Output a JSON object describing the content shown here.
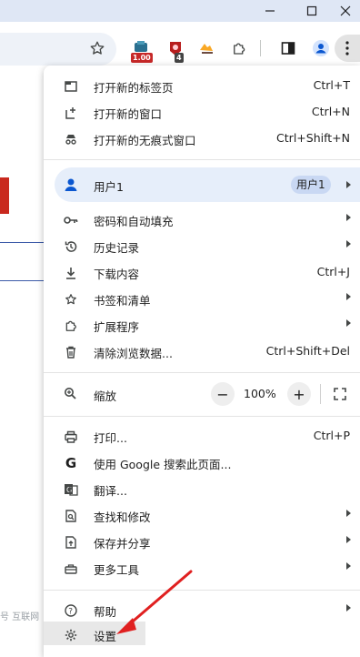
{
  "toolbar": {
    "extension_badge_1": "1.00",
    "extension_badge_2": "4"
  },
  "menu": {
    "new_tab": {
      "label": "打开新的标签页",
      "shortcut": "Ctrl+T"
    },
    "new_window": {
      "label": "打开新的窗口",
      "shortcut": "Ctrl+N"
    },
    "new_incognito": {
      "label": "打开新的无痕式窗口",
      "shortcut": "Ctrl+Shift+N"
    },
    "profile": {
      "label": "用户1",
      "chip": "用户1"
    },
    "passwords": {
      "label": "密码和自动填充"
    },
    "history": {
      "label": "历史记录"
    },
    "downloads": {
      "label": "下载内容",
      "shortcut": "Ctrl+J"
    },
    "bookmarks": {
      "label": "书签和清单"
    },
    "extensions": {
      "label": "扩展程序"
    },
    "clear_data": {
      "label": "清除浏览数据...",
      "shortcut": "Ctrl+Shift+Del"
    },
    "zoom": {
      "label": "缩放",
      "minus": "−",
      "value": "100%",
      "plus": "+"
    },
    "print": {
      "label": "打印...",
      "shortcut": "Ctrl+P"
    },
    "google_search": {
      "label": "使用 Google 搜索此页面..."
    },
    "translate": {
      "label": "翻译..."
    },
    "find_edit": {
      "label": "查找和修改"
    },
    "save_share": {
      "label": "保存并分享"
    },
    "more_tools": {
      "label": "更多工具"
    },
    "help": {
      "label": "帮助"
    },
    "settings": {
      "label": "设置"
    }
  },
  "background": {
    "footer_text": "号   互联网"
  },
  "colors": {
    "accent_blue": "#0b57d0",
    "annotation_red": "#e02020",
    "profile_highlight": "#e6eefa"
  }
}
